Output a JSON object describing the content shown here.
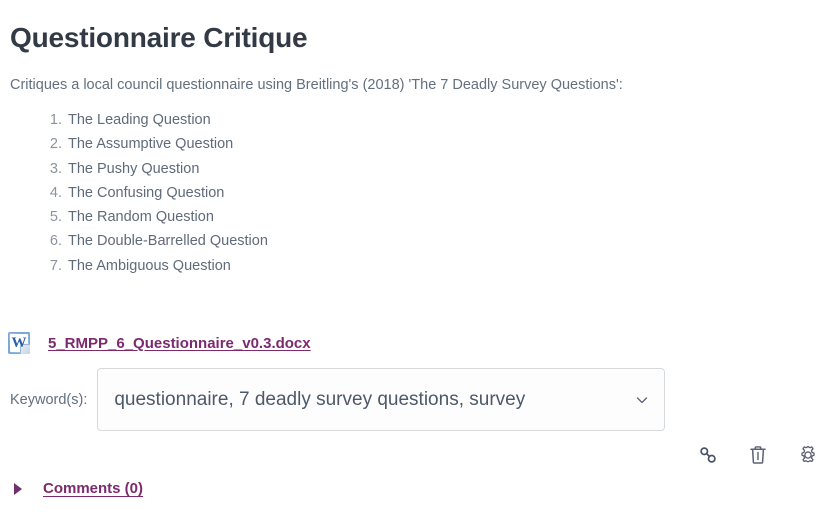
{
  "page": {
    "title": "Questionnaire Critique",
    "description": "Critiques a local council questionnaire using Breitling's (2018) 'The 7 Deadly Survey Questions':",
    "background_color": "#ffffff",
    "title_color": "#323a45",
    "text_color": "#62707f",
    "link_color": "#7c2a6e"
  },
  "question_list": [
    {
      "number": "1.",
      "label": "The Leading Question"
    },
    {
      "number": "2.",
      "label": "The Assumptive Question"
    },
    {
      "number": "3.",
      "label": "The Pushy Question"
    },
    {
      "number": "4.",
      "label": "The Confusing Question"
    },
    {
      "number": "5.",
      "label": "The Random Question"
    },
    {
      "number": "6.",
      "label": "The Double-Barrelled Question"
    },
    {
      "number": "7.",
      "label": "The Ambiguous Question"
    }
  ],
  "attachment": {
    "icon": "word-document-icon",
    "icon_glyph": "W",
    "filename": "5_RMPP_6_Questionnaire_v0.3.docx"
  },
  "keywords": {
    "label": "Keyword(s):",
    "selected": "questionnaire, 7 deadly survey questions, survey",
    "chevron_icon": "chevron-down-icon"
  },
  "actions": [
    {
      "name": "link-icon",
      "title": "Link"
    },
    {
      "name": "trash-icon",
      "title": "Delete"
    },
    {
      "name": "gear-icon",
      "title": "Settings"
    }
  ],
  "comments": {
    "toggle_icon": "triangle-right-icon",
    "label": "Comments (0)"
  }
}
